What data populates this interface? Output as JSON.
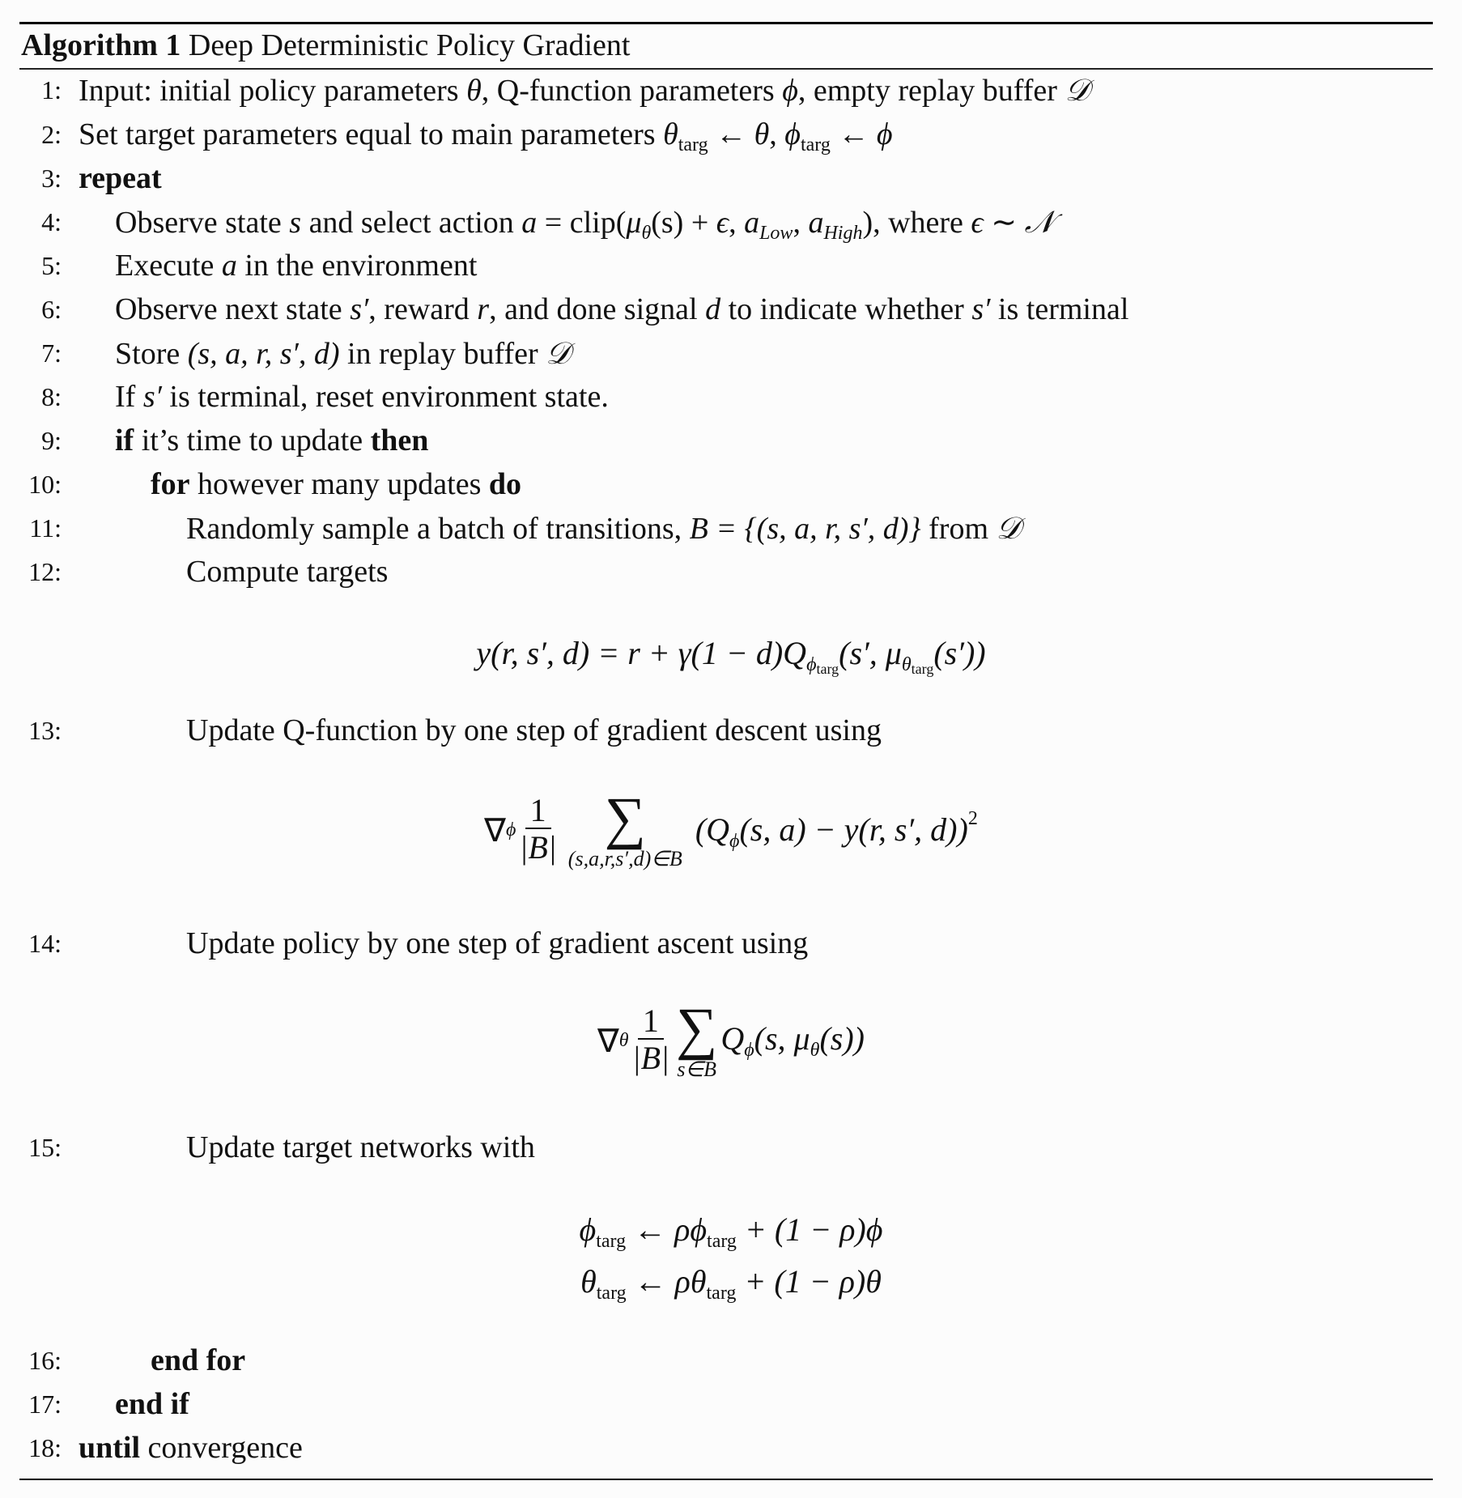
{
  "algorithm": {
    "label": "Algorithm 1",
    "title": "Deep Deterministic Policy Gradient"
  },
  "lines": [
    {
      "no": "1:",
      "text": "Input: initial policy parameters θ, Q-function parameters ϕ, empty replay buffer 𝒟"
    },
    {
      "no": "2:",
      "text": "Set target parameters equal to main parameters θ_targ ← θ, ϕ_targ ← ϕ"
    },
    {
      "no": "3:",
      "keyword": "repeat"
    },
    {
      "no": "4:",
      "text": "Observe state s and select action a = clip(μ_θ(s) + ϵ, a_Low, a_High), where ϵ ∼ 𝒩"
    },
    {
      "no": "5:",
      "text": "Execute a in the environment"
    },
    {
      "no": "6:",
      "text": "Observe next state s′, reward r, and done signal d to indicate whether s′ is terminal"
    },
    {
      "no": "7:",
      "text": "Store (s, a, r, s′, d) in replay buffer 𝒟"
    },
    {
      "no": "8:",
      "text": "If s′ is terminal, reset environment state."
    },
    {
      "no": "9:",
      "keyword": "if",
      "text": "it’s time to update",
      "keyword_end": "then"
    },
    {
      "no": "10:",
      "keyword": "for",
      "text": "however many updates",
      "keyword_end": "do"
    },
    {
      "no": "11:",
      "text": "Randomly sample a batch of transitions, B = {(s, a, r, s′, d)} from 𝒟"
    },
    {
      "no": "12:",
      "text": "Compute targets"
    },
    {
      "no": "13:",
      "text": "Update Q-function by one step of gradient descent using"
    },
    {
      "no": "14:",
      "text": "Update policy by one step of gradient ascent using"
    },
    {
      "no": "15:",
      "text": "Update target networks with"
    },
    {
      "no": "16:",
      "keyword": "end for"
    },
    {
      "no": "17:",
      "keyword": "end if"
    },
    {
      "no": "18:",
      "keyword": "until",
      "text": "convergence"
    }
  ],
  "fragments": {
    "l1a": "Input: initial policy parameters ",
    "l1b": ", Q-function parameters ",
    "l1c": ", empty replay buffer ",
    "l2a": "Set target parameters equal to main parameters ",
    "l4a": "Observe state ",
    "l4b": " and select action ",
    "l4c": " = clip(",
    "l4d": "(s) + ",
    "l4e": "), where ",
    "l5a": "Execute ",
    "l5b": " in the environment",
    "l6a": "Observe next state ",
    "l6b": ", reward ",
    "l6c": ", and done signal ",
    "l6d": " to indicate whether ",
    "l6e": " is terminal",
    "l7a": "Store ",
    "l7b": " in replay buffer ",
    "l8a": "If ",
    "l8b": " is terminal, reset environment state.",
    "l11a": "Randomly sample a batch of transitions, ",
    "l11b": " from "
  },
  "symbols": {
    "theta": "θ",
    "phi": "ϕ",
    "calD": "𝒟",
    "calN": "𝒩",
    "mu": "μ",
    "eps": "ϵ",
    "gamma": "γ",
    "rho": "ρ",
    "nabla": "∇",
    "sum": "∑",
    "arrow": "←",
    "sim": "∼",
    "targ": "targ",
    "low": "Low",
    "high": "High",
    "tuple": "(s, a, r, s′, d)",
    "batch_set": "B = {(s, a, r, s′, d)}",
    "s_prime": "s′"
  },
  "equations": {
    "targets": {
      "lhs": "y(r, s′, d) = r + γ(1 − d)Q",
      "sub_phi": "ϕ",
      "sub_targ": "targ",
      "mid": "(s′, μ",
      "sub_theta": "θ",
      "rhs": "(s′))"
    },
    "q_update": {
      "nabla": "∇",
      "sub": "ϕ",
      "num": "1",
      "den": "|B|",
      "sum": "∑",
      "limit": "(s,a,r,s′,d)∈B",
      "body": "(Q",
      "body_sub": "ϕ",
      "body_rest": "(s, a) − y(r, s′, d))",
      "power": "2"
    },
    "policy_update": {
      "nabla": "∇",
      "sub": "θ",
      "num": "1",
      "den": "|B|",
      "sum": "∑",
      "limit": "s∈B",
      "body": "Q",
      "body_sub": "ϕ",
      "body_mid": "(s, μ",
      "body_sub2": "θ",
      "body_rest": "(s))"
    },
    "target_update": [
      {
        "var": "ϕ",
        "sub": "targ",
        "mid": " ← ρϕ",
        "rest": " + (1 − ρ)ϕ"
      },
      {
        "var": "θ",
        "sub": "targ",
        "mid": " ← ρθ",
        "rest": " + (1 − ρ)θ"
      }
    ]
  }
}
